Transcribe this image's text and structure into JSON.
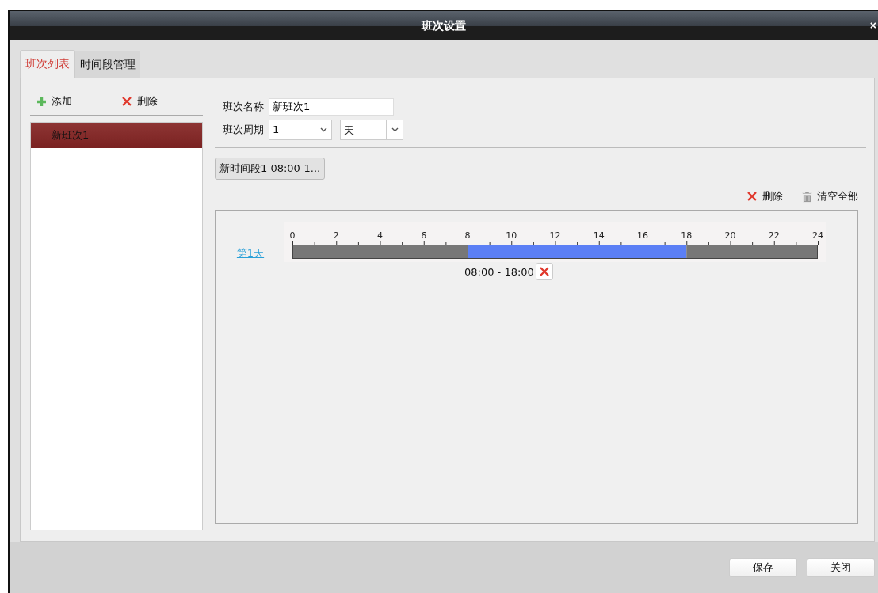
{
  "window": {
    "title": "班次设置",
    "close": "×"
  },
  "tabs": [
    {
      "label": "班次列表",
      "selected": true
    },
    {
      "label": "时间段管理",
      "selected": false
    }
  ],
  "shift_list": {
    "add": "添加",
    "delete": "删除",
    "items": [
      {
        "label": "新班次1",
        "selected": true
      }
    ]
  },
  "form": {
    "name_label": "班次名称",
    "name_value": "新班次1",
    "cycle_label": "班次周期",
    "cycle_value": "1",
    "cycle_unit": "天"
  },
  "segment_tabs": [
    {
      "label": "新时间段1 08:00-1...",
      "selected": true
    }
  ],
  "actions": {
    "delete": "删除",
    "clear_all": "清空全部"
  },
  "timeline": {
    "segment_label": "08:00 - 18:00",
    "chart_data": {
      "type": "bar",
      "orientation": "horizontal",
      "stacked": true,
      "categories": [
        "第1天"
      ],
      "series": [
        {
          "color": "#777777",
          "values": [
            8
          ]
        },
        {
          "color": "#5b7ff5",
          "values": [
            10
          ]
        },
        {
          "color": "#777777",
          "values": [
            6
          ]
        }
      ],
      "xlim": [
        0,
        24
      ],
      "xticks": [
        0,
        2,
        4,
        6,
        8,
        10,
        12,
        14,
        16,
        18,
        20,
        22,
        24
      ]
    }
  },
  "buttons": [
    "保存",
    "关闭"
  ]
}
